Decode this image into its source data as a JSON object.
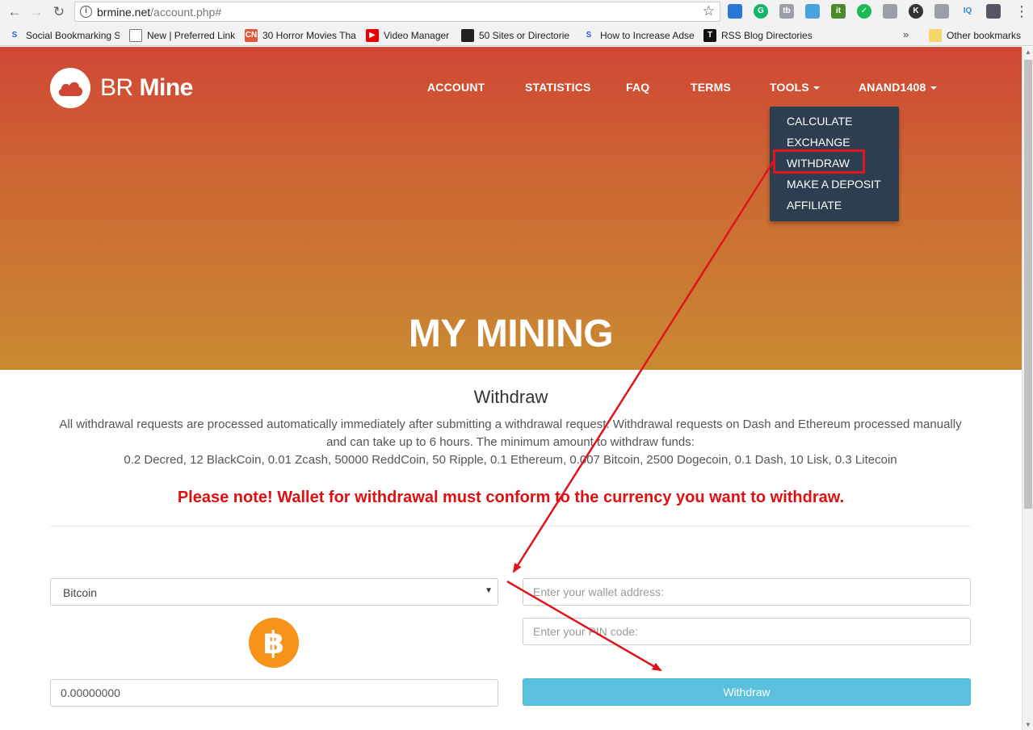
{
  "browser": {
    "url_host": "brmine.net",
    "url_path": "/account.php#",
    "bookmarks": [
      {
        "label": "Social Bookmarking S"
      },
      {
        "label": "New | Preferred Link"
      },
      {
        "label": "30 Horror Movies Tha"
      },
      {
        "label": "Video Manager"
      },
      {
        "label": "50 Sites or Directorie"
      },
      {
        "label": "How to Increase Adse"
      },
      {
        "label": "RSS Blog Directories"
      }
    ],
    "other_bookmarks": "Other bookmarks"
  },
  "site": {
    "logo_light": "BR",
    "logo_bold": "Mine",
    "nav": [
      "ACCOUNT",
      "STATISTICS",
      "FAQ",
      "TERMS",
      "TOOLS",
      "ANAND1408"
    ],
    "tools_menu": [
      "CALCULATE",
      "EXCHANGE",
      "WITHDRAW",
      "MAKE A DEPOSIT",
      "AFFILIATE"
    ],
    "hero_title": "MY MINING"
  },
  "withdraw": {
    "title": "Withdraw",
    "info_line1": "All withdrawal requests are processed automatically immediately after submitting a withdrawal request. Withdrawal requests on Dash and Ethereum processed manually and can take up to 6 hours. The minimum amount to withdraw funds:",
    "info_line2": "0.2 Decred, 12 BlackCoin, 0.01 Zcash, 50000 ReddCoin, 50 Ripple, 0.1 Ethereum, 0.007 Bitcoin, 2500 Dogecoin, 0.1 Dash, 10 Lisk, 0.3 Litecoin",
    "note": "Please note! Wallet for withdrawal must conform to the currency you want to withdraw.",
    "currency_selected": "Bitcoin",
    "currency_symbol": "฿",
    "wallet_placeholder": "Enter your wallet address:",
    "pin_placeholder": "Enter your PIN code:",
    "amount_value": "0.00000000",
    "button_label": "Withdraw"
  },
  "colors": {
    "accent": "#5bc0de",
    "dropdown_bg": "#2c3e50",
    "note_red": "#e01010",
    "annotation_red": "#e0141b",
    "bitcoin_orange": "#f7931a"
  }
}
